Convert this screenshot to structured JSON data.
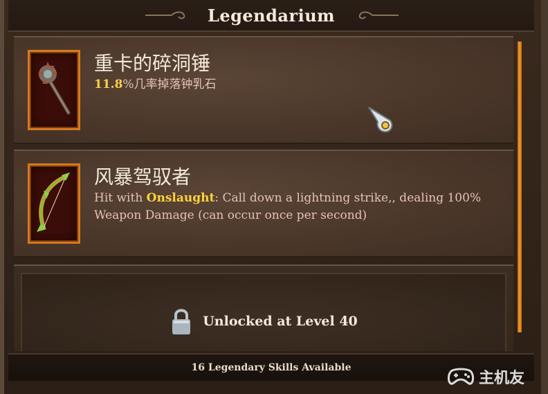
{
  "window": {
    "title": "Legendarium"
  },
  "skills": [
    {
      "name": "重卡的碎洞锤",
      "chance": "11.8",
      "chance_suffix": "%几率掉落钟乳石",
      "icon": "spiked-mace-icon"
    },
    {
      "name": "风暴驾驭者",
      "desc_prefix": "Hit with ",
      "keyword": "Onslaught",
      "desc_rest": ": Call down a lightning strike,, dealing 100% Weapon Damage (can occur once per second)",
      "icon": "green-bow-icon"
    }
  ],
  "locked_slot": {
    "label": "Unlocked at Level 40",
    "icon": "padlock-icon"
  },
  "footer": {
    "label": "16 Legendary Skills Available"
  },
  "watermark": {
    "text": "主机友",
    "icon": "gamepad-icon"
  },
  "colors": {
    "accent": "#ffcf4a",
    "frame_orange": "#d67a1c",
    "scroll": "#f29a2a"
  }
}
